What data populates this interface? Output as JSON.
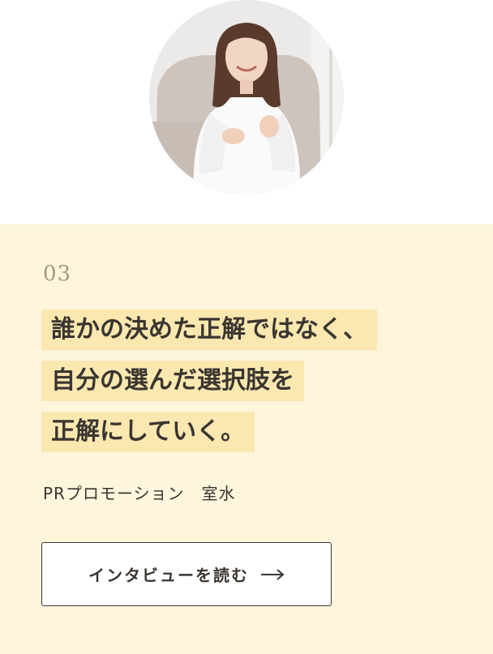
{
  "article": {
    "number": "03",
    "headline_lines": [
      "誰かの決めた正解ではなく、",
      "自分の選んだ選択肢を",
      "正解にしていく。"
    ],
    "person": "PRプロモーション　室水",
    "cta_label": "インタビューを読む",
    "cta_icon": "arrow-right-icon"
  },
  "colors": {
    "panel_background": "#fdf6dd",
    "highlight": "#fbe8b0",
    "number": "#a89878",
    "text": "#3a3530"
  }
}
